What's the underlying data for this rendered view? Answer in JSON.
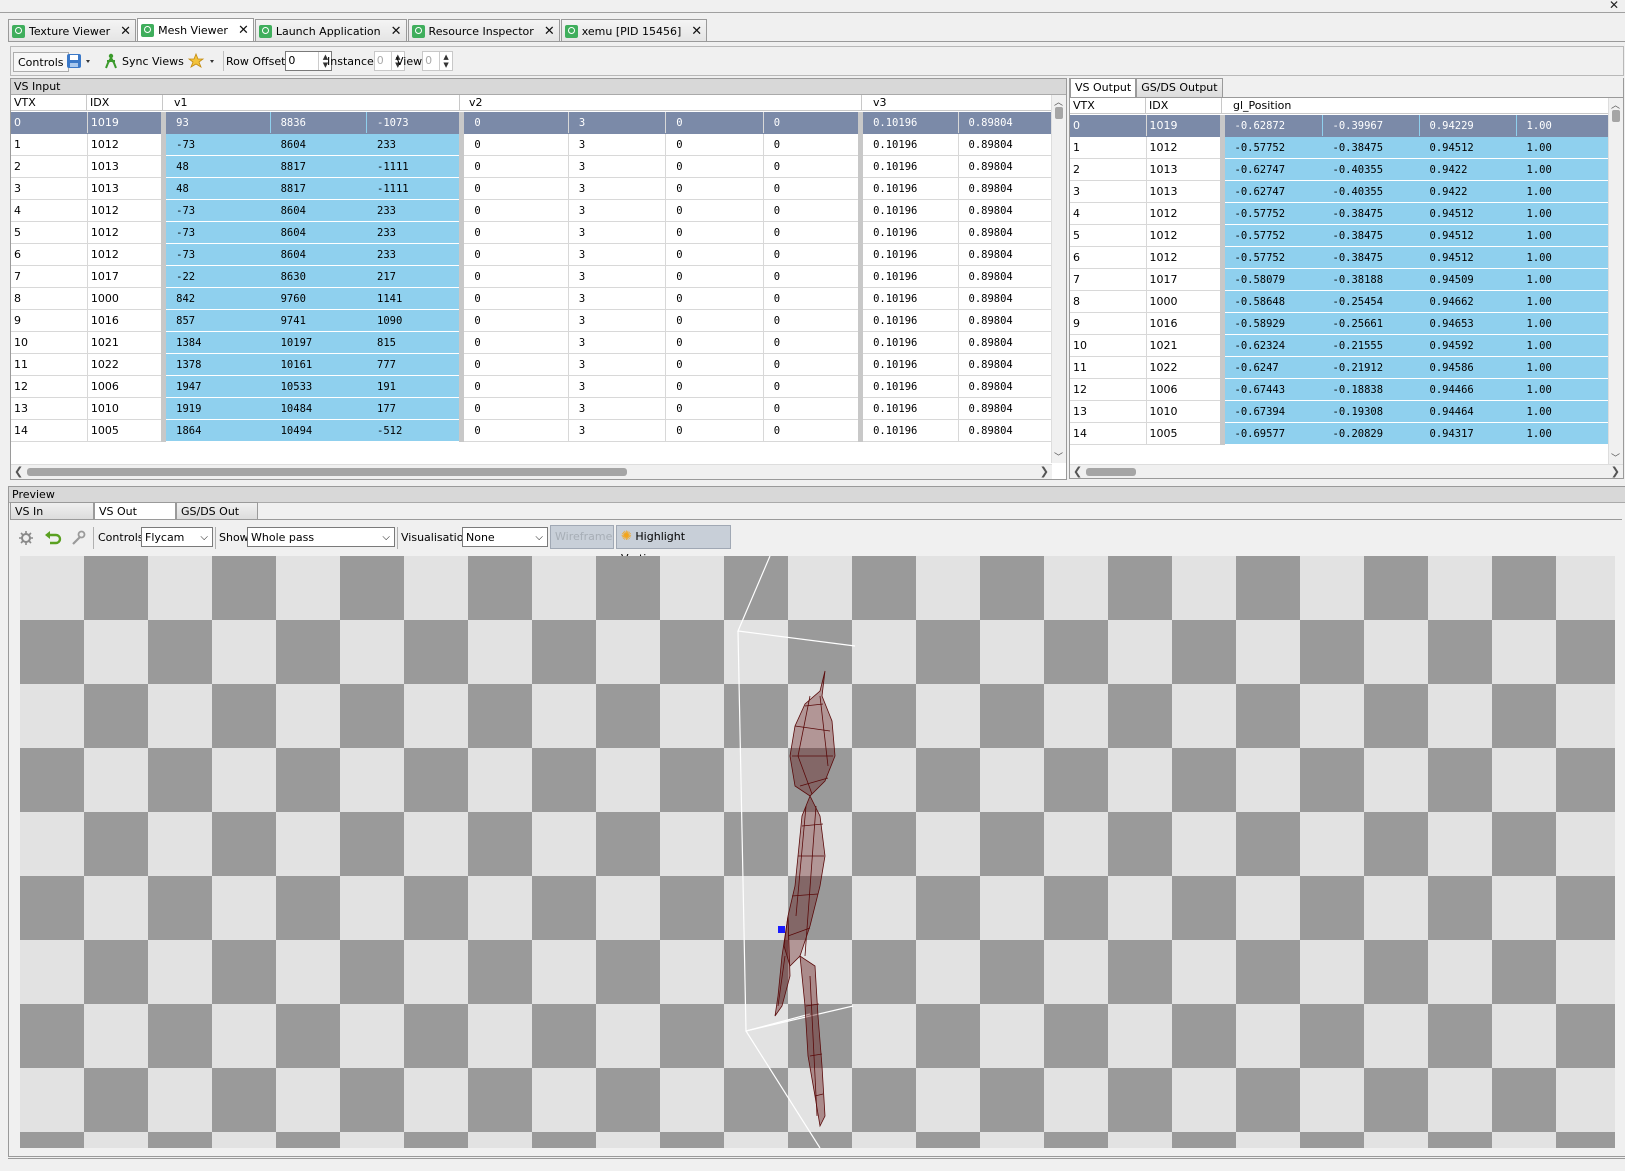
{
  "doc_tabs": [
    {
      "label": "Texture Viewer"
    },
    {
      "label": "Mesh Viewer"
    },
    {
      "label": "Launch Application"
    },
    {
      "label": "Resource Inspector"
    },
    {
      "label": "xemu [PID 15456]"
    }
  ],
  "toolbar": {
    "controls_label": "Controls",
    "sync_views_label": "Sync Views",
    "row_offset_label": "Row Offset",
    "row_offset_value": "0",
    "instance_label": "Instance",
    "instance_value": "0",
    "view_label": "View",
    "view_value": "0"
  },
  "vs_input": {
    "title": "VS Input",
    "columns": {
      "vtx": "VTX",
      "idx": "IDX",
      "v1": "v1",
      "v2": "v2",
      "v3": "v3"
    },
    "rows": [
      {
        "vtx": "0",
        "idx": "1019",
        "v1": [
          "93",
          "8836",
          "-1073"
        ],
        "v2": [
          "0",
          "3",
          "0",
          "0"
        ],
        "v3": [
          "0.10196",
          "0.89804"
        ]
      },
      {
        "vtx": "1",
        "idx": "1012",
        "v1": [
          "-73",
          "8604",
          "233"
        ],
        "v2": [
          "0",
          "3",
          "0",
          "0"
        ],
        "v3": [
          "0.10196",
          "0.89804"
        ]
      },
      {
        "vtx": "2",
        "idx": "1013",
        "v1": [
          "48",
          "8817",
          "-1111"
        ],
        "v2": [
          "0",
          "3",
          "0",
          "0"
        ],
        "v3": [
          "0.10196",
          "0.89804"
        ]
      },
      {
        "vtx": "3",
        "idx": "1013",
        "v1": [
          "48",
          "8817",
          "-1111"
        ],
        "v2": [
          "0",
          "3",
          "0",
          "0"
        ],
        "v3": [
          "0.10196",
          "0.89804"
        ]
      },
      {
        "vtx": "4",
        "idx": "1012",
        "v1": [
          "-73",
          "8604",
          "233"
        ],
        "v2": [
          "0",
          "3",
          "0",
          "0"
        ],
        "v3": [
          "0.10196",
          "0.89804"
        ]
      },
      {
        "vtx": "5",
        "idx": "1012",
        "v1": [
          "-73",
          "8604",
          "233"
        ],
        "v2": [
          "0",
          "3",
          "0",
          "0"
        ],
        "v3": [
          "0.10196",
          "0.89804"
        ]
      },
      {
        "vtx": "6",
        "idx": "1012",
        "v1": [
          "-73",
          "8604",
          "233"
        ],
        "v2": [
          "0",
          "3",
          "0",
          "0"
        ],
        "v3": [
          "0.10196",
          "0.89804"
        ]
      },
      {
        "vtx": "7",
        "idx": "1017",
        "v1": [
          "-22",
          "8630",
          "217"
        ],
        "v2": [
          "0",
          "3",
          "0",
          "0"
        ],
        "v3": [
          "0.10196",
          "0.89804"
        ]
      },
      {
        "vtx": "8",
        "idx": "1000",
        "v1": [
          "842",
          "9760",
          "1141"
        ],
        "v2": [
          "0",
          "3",
          "0",
          "0"
        ],
        "v3": [
          "0.10196",
          "0.89804"
        ]
      },
      {
        "vtx": "9",
        "idx": "1016",
        "v1": [
          "857",
          "9741",
          "1090"
        ],
        "v2": [
          "0",
          "3",
          "0",
          "0"
        ],
        "v3": [
          "0.10196",
          "0.89804"
        ]
      },
      {
        "vtx": "10",
        "idx": "1021",
        "v1": [
          "1384",
          "10197",
          "815"
        ],
        "v2": [
          "0",
          "3",
          "0",
          "0"
        ],
        "v3": [
          "0.10196",
          "0.89804"
        ]
      },
      {
        "vtx": "11",
        "idx": "1022",
        "v1": [
          "1378",
          "10161",
          "777"
        ],
        "v2": [
          "0",
          "3",
          "0",
          "0"
        ],
        "v3": [
          "0.10196",
          "0.89804"
        ]
      },
      {
        "vtx": "12",
        "idx": "1006",
        "v1": [
          "1947",
          "10533",
          "191"
        ],
        "v2": [
          "0",
          "3",
          "0",
          "0"
        ],
        "v3": [
          "0.10196",
          "0.89804"
        ]
      },
      {
        "vtx": "13",
        "idx": "1010",
        "v1": [
          "1919",
          "10484",
          "177"
        ],
        "v2": [
          "0",
          "3",
          "0",
          "0"
        ],
        "v3": [
          "0.10196",
          "0.89804"
        ]
      },
      {
        "vtx": "14",
        "idx": "1005",
        "v1": [
          "1864",
          "10494",
          "-512"
        ],
        "v2": [
          "0",
          "3",
          "0",
          "0"
        ],
        "v3": [
          "0.10196",
          "0.89804"
        ]
      }
    ]
  },
  "vs_output": {
    "tabs": [
      "VS Output",
      "GS/DS Output"
    ],
    "columns": {
      "vtx": "VTX",
      "idx": "IDX",
      "pos": "gl_Position"
    },
    "rows": [
      {
        "vtx": "0",
        "idx": "1019",
        "pos": [
          "-0.62872",
          "-0.39967",
          "0.94229",
          "1.00"
        ]
      },
      {
        "vtx": "1",
        "idx": "1012",
        "pos": [
          "-0.57752",
          "-0.38475",
          "0.94512",
          "1.00"
        ]
      },
      {
        "vtx": "2",
        "idx": "1013",
        "pos": [
          "-0.62747",
          "-0.40355",
          "0.9422",
          "1.00"
        ]
      },
      {
        "vtx": "3",
        "idx": "1013",
        "pos": [
          "-0.62747",
          "-0.40355",
          "0.9422",
          "1.00"
        ]
      },
      {
        "vtx": "4",
        "idx": "1012",
        "pos": [
          "-0.57752",
          "-0.38475",
          "0.94512",
          "1.00"
        ]
      },
      {
        "vtx": "5",
        "idx": "1012",
        "pos": [
          "-0.57752",
          "-0.38475",
          "0.94512",
          "1.00"
        ]
      },
      {
        "vtx": "6",
        "idx": "1012",
        "pos": [
          "-0.57752",
          "-0.38475",
          "0.94512",
          "1.00"
        ]
      },
      {
        "vtx": "7",
        "idx": "1017",
        "pos": [
          "-0.58079",
          "-0.38188",
          "0.94509",
          "1.00"
        ]
      },
      {
        "vtx": "8",
        "idx": "1000",
        "pos": [
          "-0.58648",
          "-0.25454",
          "0.94662",
          "1.00"
        ]
      },
      {
        "vtx": "9",
        "idx": "1016",
        "pos": [
          "-0.58929",
          "-0.25661",
          "0.94653",
          "1.00"
        ]
      },
      {
        "vtx": "10",
        "idx": "1021",
        "pos": [
          "-0.62324",
          "-0.21555",
          "0.94592",
          "1.00"
        ]
      },
      {
        "vtx": "11",
        "idx": "1022",
        "pos": [
          "-0.6247",
          "-0.21912",
          "0.94586",
          "1.00"
        ]
      },
      {
        "vtx": "12",
        "idx": "1006",
        "pos": [
          "-0.67443",
          "-0.18838",
          "0.94466",
          "1.00"
        ]
      },
      {
        "vtx": "13",
        "idx": "1010",
        "pos": [
          "-0.67394",
          "-0.19308",
          "0.94464",
          "1.00"
        ]
      },
      {
        "vtx": "14",
        "idx": "1005",
        "pos": [
          "-0.69577",
          "-0.20829",
          "0.94317",
          "1.00"
        ]
      }
    ]
  },
  "preview": {
    "title": "Preview",
    "tabs": [
      "VS In",
      "VS Out",
      "GS/DS Out"
    ],
    "controls_label": "Controls",
    "controls_value": "Flycam",
    "show_label": "Show",
    "show_value": "Whole pass",
    "visualisation_label": "Visualisation",
    "visualisation_value": "None",
    "wireframe_label": "Wireframe",
    "highlight_label": "Highlight Vertices"
  },
  "colors": {
    "selection": "#7b8aa8",
    "data_cell": "#8fd0ee",
    "mesh": "#5a0a0a",
    "tab_icon": "#3fae5c"
  }
}
